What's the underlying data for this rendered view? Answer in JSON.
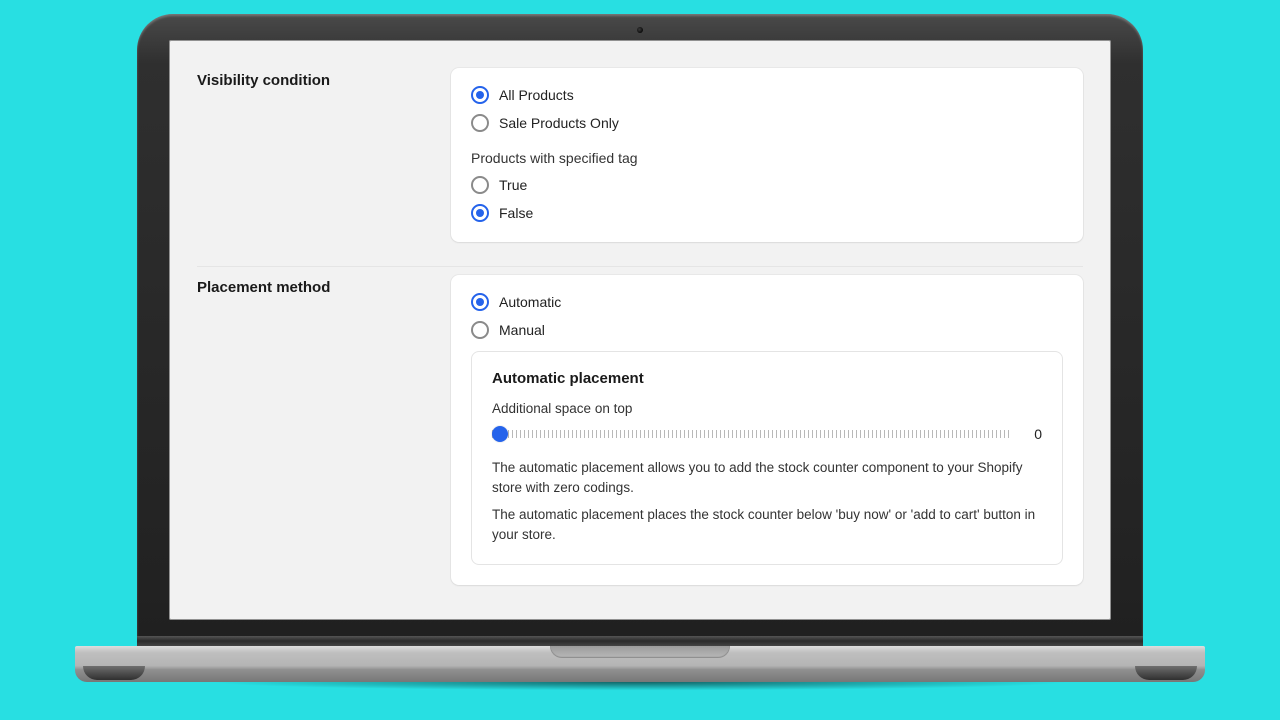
{
  "colors": {
    "accent": "#2563eb",
    "page_bg": "#28dfe2"
  },
  "visibility": {
    "title": "Visibility condition",
    "options": {
      "all_products": {
        "label": "All Products",
        "selected": true
      },
      "sale_only": {
        "label": "Sale Products Only",
        "selected": false
      }
    },
    "tag_group": {
      "heading": "Products with specified tag",
      "true": {
        "label": "True",
        "selected": false
      },
      "false": {
        "label": "False",
        "selected": true
      }
    }
  },
  "placement": {
    "title": "Placement method",
    "options": {
      "automatic": {
        "label": "Automatic",
        "selected": true
      },
      "manual": {
        "label": "Manual",
        "selected": false
      }
    },
    "automatic_panel": {
      "title": "Automatic placement",
      "space_on_top": {
        "label": "Additional space on top",
        "value": "0",
        "min": 0,
        "max": 100
      },
      "desc1": "The automatic placement allows you to add the stock counter component to your Shopify store with zero codings.",
      "desc2": "The automatic placement places the stock counter below 'buy now' or 'add to cart' button in your store."
    }
  }
}
